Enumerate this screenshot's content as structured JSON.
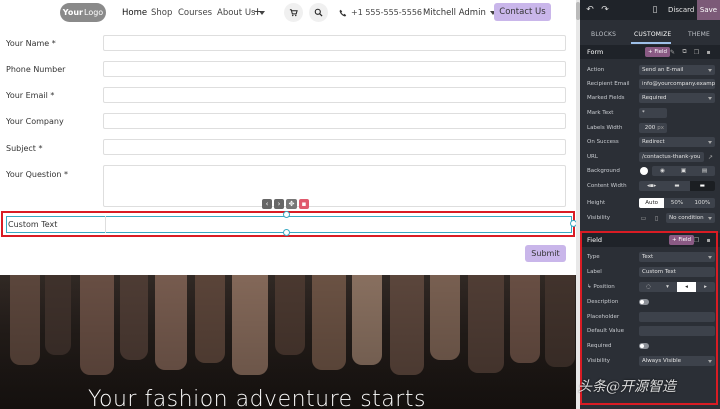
{
  "site": {
    "logo": {
      "bold": "Your",
      "rest": "Logo"
    },
    "nav": [
      {
        "label": "Home",
        "active": true
      },
      {
        "label": "Shop"
      },
      {
        "label": "Courses"
      },
      {
        "label": "About Us"
      }
    ],
    "nav_add": "+",
    "phone": "+1 555-555-5556",
    "user": "Mitchell Admin",
    "contact_button": "Contact Us",
    "form": {
      "fields": [
        {
          "label": "Your Name *"
        },
        {
          "label": "Phone Number"
        },
        {
          "label": "Your Email *"
        },
        {
          "label": "Your Company"
        },
        {
          "label": "Subject *"
        },
        {
          "label": "Your Question *"
        }
      ],
      "selected_field": {
        "label": "Custom Text"
      },
      "submit": "Submit"
    },
    "hero_text": "Your fashion adventure starts"
  },
  "panel": {
    "discard": "Discard",
    "save": "Save",
    "tabs": [
      {
        "label": "BLOCKS"
      },
      {
        "label": "CUSTOMIZE",
        "active": true
      },
      {
        "label": "THEME"
      }
    ],
    "form_section": {
      "title": "Form",
      "add_field": "+ Field",
      "rows": {
        "action": {
          "label": "Action",
          "value": "Send an E-mail"
        },
        "recipient": {
          "label": "Recipient Email",
          "value": "info@yourcompany.examp"
        },
        "marked": {
          "label": "Marked Fields",
          "value": "Required"
        },
        "mark_text": {
          "label": "Mark Text",
          "value": "*"
        },
        "labels_width": {
          "label": "Labels Width",
          "value": "200",
          "unit": "px"
        },
        "on_success": {
          "label": "On Success",
          "value": "Redirect"
        },
        "url": {
          "label": "URL",
          "value": "/contactus-thank-you"
        },
        "background": {
          "label": "Background"
        },
        "content_width": {
          "label": "Content Width"
        },
        "height": {
          "label": "Height",
          "options": [
            "Auto",
            "50%",
            "100%"
          ]
        },
        "visibility": {
          "label": "Visibility",
          "value": "No condition"
        }
      }
    },
    "field_section": {
      "title": "Field",
      "add_field": "+ Field",
      "rows": {
        "type": {
          "label": "Type",
          "value": "Text"
        },
        "label": {
          "label": "Label",
          "value": "Custom Text"
        },
        "position": {
          "label": "Position"
        },
        "description": {
          "label": "Description"
        },
        "placeholder": {
          "label": "Placeholder",
          "value": ""
        },
        "default_value": {
          "label": "Default Value",
          "value": ""
        },
        "required": {
          "label": "Required"
        },
        "visibility": {
          "label": "Visibility",
          "value": "Always Visible"
        }
      }
    }
  },
  "watermark": "头条@开源智造",
  "colors": {
    "accent": "#c9b6ea",
    "panel_bg": "#2b2f36",
    "highlight": "#d91c24",
    "selection": "#39a9c2",
    "save": "#7c5a78"
  }
}
